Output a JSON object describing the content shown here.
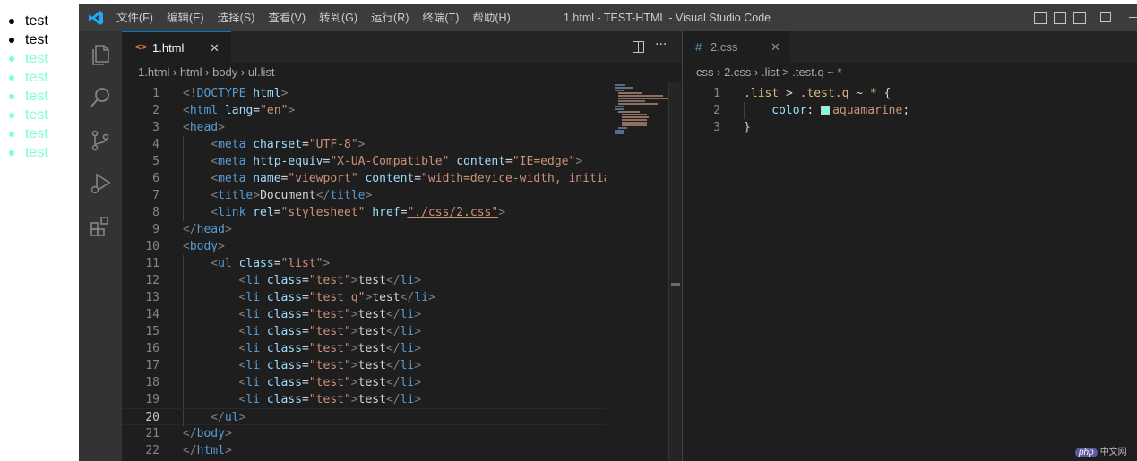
{
  "preview": {
    "items": [
      {
        "text": "test",
        "color": "#000000"
      },
      {
        "text": "test",
        "color": "#000000"
      },
      {
        "text": "test",
        "color": "#7fffd4"
      },
      {
        "text": "test",
        "color": "#7fffd4"
      },
      {
        "text": "test",
        "color": "#7fffd4"
      },
      {
        "text": "test",
        "color": "#7fffd4"
      },
      {
        "text": "test",
        "color": "#7fffd4"
      },
      {
        "text": "test",
        "color": "#7fffd4"
      }
    ]
  },
  "titlebar": {
    "menus": [
      "文件(F)",
      "编辑(E)",
      "选择(S)",
      "查看(V)",
      "转到(G)",
      "运行(R)",
      "终端(T)",
      "帮助(H)"
    ],
    "window_title": "1.html - TEST-HTML - Visual Studio Code"
  },
  "activity_bar": {
    "icons": [
      "files-icon",
      "search-icon",
      "source-control-icon",
      "run-debug-icon",
      "extensions-icon"
    ]
  },
  "left_editor": {
    "tab": {
      "label": "1.html",
      "close": "✕"
    },
    "breadcrumb": [
      "1.html",
      "html",
      "body",
      "ul.list"
    ],
    "current_line": 20,
    "lines": [
      {
        "n": "1",
        "indent": 0,
        "tokens": [
          [
            "br",
            "<!"
          ],
          [
            "tg",
            "DOCTYPE"
          ],
          [
            "tx",
            " "
          ],
          [
            "at",
            "html"
          ],
          [
            "br",
            ">"
          ]
        ]
      },
      {
        "n": "2",
        "indent": 0,
        "tokens": [
          [
            "br",
            "<"
          ],
          [
            "tg",
            "html"
          ],
          [
            "tx",
            " "
          ],
          [
            "at",
            "lang"
          ],
          [
            "tx",
            "="
          ],
          [
            "st",
            "\"en\""
          ],
          [
            "br",
            ">"
          ]
        ]
      },
      {
        "n": "3",
        "indent": 0,
        "tokens": [
          [
            "br",
            "<"
          ],
          [
            "tg",
            "head"
          ],
          [
            "br",
            ">"
          ]
        ]
      },
      {
        "n": "4",
        "indent": 1,
        "tokens": [
          [
            "br",
            "<"
          ],
          [
            "tg",
            "meta"
          ],
          [
            "tx",
            " "
          ],
          [
            "at",
            "charset"
          ],
          [
            "tx",
            "="
          ],
          [
            "st",
            "\"UTF-8\""
          ],
          [
            "br",
            ">"
          ]
        ]
      },
      {
        "n": "5",
        "indent": 1,
        "tokens": [
          [
            "br",
            "<"
          ],
          [
            "tg",
            "meta"
          ],
          [
            "tx",
            " "
          ],
          [
            "at",
            "http-equiv"
          ],
          [
            "tx",
            "="
          ],
          [
            "st",
            "\"X-UA-Compatible\""
          ],
          [
            "tx",
            " "
          ],
          [
            "at",
            "content"
          ],
          [
            "tx",
            "="
          ],
          [
            "st",
            "\"IE=edge\""
          ],
          [
            "br",
            ">"
          ]
        ]
      },
      {
        "n": "6",
        "indent": 1,
        "tokens": [
          [
            "br",
            "<"
          ],
          [
            "tg",
            "meta"
          ],
          [
            "tx",
            " "
          ],
          [
            "at",
            "name"
          ],
          [
            "tx",
            "="
          ],
          [
            "st",
            "\"viewport\""
          ],
          [
            "tx",
            " "
          ],
          [
            "at",
            "content"
          ],
          [
            "tx",
            "="
          ],
          [
            "st",
            "\"width=device-width, initial"
          ]
        ]
      },
      {
        "n": "7",
        "indent": 1,
        "tokens": [
          [
            "br",
            "<"
          ],
          [
            "tg",
            "title"
          ],
          [
            "br",
            ">"
          ],
          [
            "tx",
            "Document"
          ],
          [
            "br",
            "</"
          ],
          [
            "tg",
            "title"
          ],
          [
            "br",
            ">"
          ]
        ]
      },
      {
        "n": "8",
        "indent": 1,
        "tokens": [
          [
            "br",
            "<"
          ],
          [
            "tg",
            "link"
          ],
          [
            "tx",
            " "
          ],
          [
            "at",
            "rel"
          ],
          [
            "tx",
            "="
          ],
          [
            "st",
            "\"stylesheet\""
          ],
          [
            "tx",
            " "
          ],
          [
            "at",
            "href"
          ],
          [
            "tx",
            "="
          ],
          [
            "st",
            "\"./css/2.css\""
          ],
          [
            "br",
            ">"
          ]
        ]
      },
      {
        "n": "9",
        "indent": 0,
        "tokens": [
          [
            "br",
            "</"
          ],
          [
            "tg",
            "head"
          ],
          [
            "br",
            ">"
          ]
        ]
      },
      {
        "n": "10",
        "indent": 0,
        "tokens": [
          [
            "br",
            "<"
          ],
          [
            "tg",
            "body"
          ],
          [
            "br",
            ">"
          ]
        ]
      },
      {
        "n": "11",
        "indent": 1,
        "tokens": [
          [
            "br",
            "<"
          ],
          [
            "tg",
            "ul"
          ],
          [
            "tx",
            " "
          ],
          [
            "at",
            "class"
          ],
          [
            "tx",
            "="
          ],
          [
            "st",
            "\"list\""
          ],
          [
            "br",
            ">"
          ]
        ]
      },
      {
        "n": "12",
        "indent": 2,
        "tokens": [
          [
            "br",
            "<"
          ],
          [
            "tg",
            "li"
          ],
          [
            "tx",
            " "
          ],
          [
            "at",
            "class"
          ],
          [
            "tx",
            "="
          ],
          [
            "st",
            "\"test\""
          ],
          [
            "br",
            ">"
          ],
          [
            "tx",
            "test"
          ],
          [
            "br",
            "</"
          ],
          [
            "tg",
            "li"
          ],
          [
            "br",
            ">"
          ]
        ]
      },
      {
        "n": "13",
        "indent": 2,
        "tokens": [
          [
            "br",
            "<"
          ],
          [
            "tg",
            "li"
          ],
          [
            "tx",
            " "
          ],
          [
            "at",
            "class"
          ],
          [
            "tx",
            "="
          ],
          [
            "st",
            "\"test q\""
          ],
          [
            "br",
            ">"
          ],
          [
            "tx",
            "test"
          ],
          [
            "br",
            "</"
          ],
          [
            "tg",
            "li"
          ],
          [
            "br",
            ">"
          ]
        ]
      },
      {
        "n": "14",
        "indent": 2,
        "tokens": [
          [
            "br",
            "<"
          ],
          [
            "tg",
            "li"
          ],
          [
            "tx",
            " "
          ],
          [
            "at",
            "class"
          ],
          [
            "tx",
            "="
          ],
          [
            "st",
            "\"test\""
          ],
          [
            "br",
            ">"
          ],
          [
            "tx",
            "test"
          ],
          [
            "br",
            "</"
          ],
          [
            "tg",
            "li"
          ],
          [
            "br",
            ">"
          ]
        ]
      },
      {
        "n": "15",
        "indent": 2,
        "tokens": [
          [
            "br",
            "<"
          ],
          [
            "tg",
            "li"
          ],
          [
            "tx",
            " "
          ],
          [
            "at",
            "class"
          ],
          [
            "tx",
            "="
          ],
          [
            "st",
            "\"test\""
          ],
          [
            "br",
            ">"
          ],
          [
            "tx",
            "test"
          ],
          [
            "br",
            "</"
          ],
          [
            "tg",
            "li"
          ],
          [
            "br",
            ">"
          ]
        ]
      },
      {
        "n": "16",
        "indent": 2,
        "tokens": [
          [
            "br",
            "<"
          ],
          [
            "tg",
            "li"
          ],
          [
            "tx",
            " "
          ],
          [
            "at",
            "class"
          ],
          [
            "tx",
            "="
          ],
          [
            "st",
            "\"test\""
          ],
          [
            "br",
            ">"
          ],
          [
            "tx",
            "test"
          ],
          [
            "br",
            "</"
          ],
          [
            "tg",
            "li"
          ],
          [
            "br",
            ">"
          ]
        ]
      },
      {
        "n": "17",
        "indent": 2,
        "tokens": [
          [
            "br",
            "<"
          ],
          [
            "tg",
            "li"
          ],
          [
            "tx",
            " "
          ],
          [
            "at",
            "class"
          ],
          [
            "tx",
            "="
          ],
          [
            "st",
            "\"test\""
          ],
          [
            "br",
            ">"
          ],
          [
            "tx",
            "test"
          ],
          [
            "br",
            "</"
          ],
          [
            "tg",
            "li"
          ],
          [
            "br",
            ">"
          ]
        ]
      },
      {
        "n": "18",
        "indent": 2,
        "tokens": [
          [
            "br",
            "<"
          ],
          [
            "tg",
            "li"
          ],
          [
            "tx",
            " "
          ],
          [
            "at",
            "class"
          ],
          [
            "tx",
            "="
          ],
          [
            "st",
            "\"test\""
          ],
          [
            "br",
            ">"
          ],
          [
            "tx",
            "test"
          ],
          [
            "br",
            "</"
          ],
          [
            "tg",
            "li"
          ],
          [
            "br",
            ">"
          ]
        ]
      },
      {
        "n": "19",
        "indent": 2,
        "tokens": [
          [
            "br",
            "<"
          ],
          [
            "tg",
            "li"
          ],
          [
            "tx",
            " "
          ],
          [
            "at",
            "class"
          ],
          [
            "tx",
            "="
          ],
          [
            "st",
            "\"test\""
          ],
          [
            "br",
            ">"
          ],
          [
            "tx",
            "test"
          ],
          [
            "br",
            "</"
          ],
          [
            "tg",
            "li"
          ],
          [
            "br",
            ">"
          ]
        ]
      },
      {
        "n": "20",
        "indent": 1,
        "tokens": [
          [
            "br",
            "</"
          ],
          [
            "tg",
            "ul"
          ],
          [
            "br",
            ">"
          ]
        ]
      },
      {
        "n": "21",
        "indent": 0,
        "tokens": [
          [
            "br",
            "</"
          ],
          [
            "tg",
            "body"
          ],
          [
            "br",
            ">"
          ]
        ]
      },
      {
        "n": "22",
        "indent": 0,
        "tokens": [
          [
            "br",
            "</"
          ],
          [
            "tg",
            "html"
          ],
          [
            "br",
            ">"
          ]
        ]
      }
    ]
  },
  "right_editor": {
    "tab": {
      "label": "2.css",
      "close": "✕"
    },
    "breadcrumb": [
      "css",
      "2.css",
      ".list > .test.q ~ *"
    ],
    "lines": [
      {
        "n": "1",
        "indent": 0,
        "tokens": [
          [
            "sel",
            ".list"
          ],
          [
            "tx",
            " > "
          ],
          [
            "sel",
            ".test.q"
          ],
          [
            "tx",
            " ~ "
          ],
          [
            "sel",
            "*"
          ],
          [
            "tx",
            " {"
          ]
        ]
      },
      {
        "n": "2",
        "indent": 1,
        "tokens": [
          [
            "pr",
            "color"
          ],
          [
            "tx",
            ": "
          ],
          [
            "swatch",
            "#7fffd4"
          ],
          [
            "st",
            "aquamarine"
          ],
          [
            "tx",
            ";"
          ]
        ]
      },
      {
        "n": "3",
        "indent": 0,
        "tokens": [
          [
            "tx",
            "}"
          ]
        ]
      }
    ]
  },
  "colors": {
    "accent": "#007acc",
    "aquamarine": "#7fffd4"
  },
  "watermark": {
    "badge": "php",
    "text": "中文网"
  }
}
